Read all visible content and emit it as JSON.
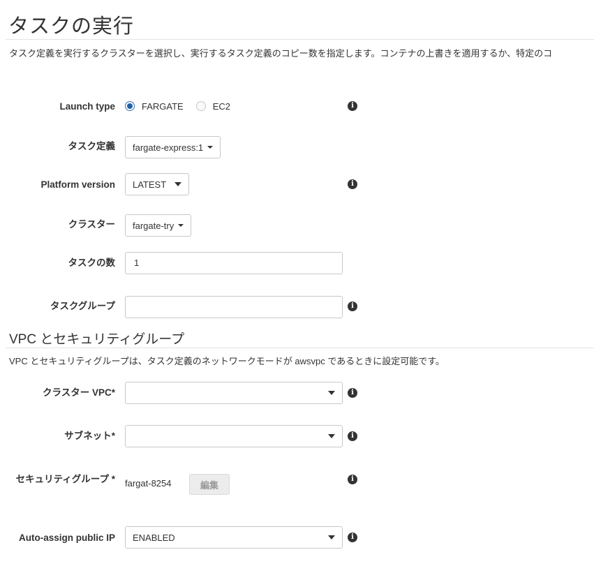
{
  "page": {
    "title": "タスクの実行",
    "description": "タスク定義を実行するクラスターを選択し、実行するタスク定義のコピー数を指定します。コンテナの上書きを適用するか、特定のコ"
  },
  "launch_type": {
    "label": "Launch type",
    "options": [
      "FARGATE",
      "EC2"
    ],
    "selected": "FARGATE"
  },
  "task_definition": {
    "label": "タスク定義",
    "value": "fargate-express:1"
  },
  "platform_version": {
    "label": "Platform version",
    "value": "LATEST"
  },
  "cluster": {
    "label": "クラスター",
    "value": "fargate-try"
  },
  "task_count": {
    "label": "タスクの数",
    "value": "1"
  },
  "task_group": {
    "label": "タスクグループ",
    "value": ""
  },
  "vpc_section": {
    "title": "VPC とセキュリティグループ",
    "description": "VPC とセキュリティグループは、タスク定義のネットワークモードが awsvpc であるときに設定可能です。"
  },
  "cluster_vpc": {
    "label": "クラスター VPC*",
    "value": ""
  },
  "subnet": {
    "label": "サブネット*",
    "value": ""
  },
  "security_group": {
    "label": "セキュリティグループ *",
    "value": "fargat-8254",
    "edit_label": "編集"
  },
  "auto_assign_ip": {
    "label": "Auto-assign public IP",
    "value": "ENABLED"
  },
  "icons": {
    "info": "info-icon",
    "info_glyph": "i"
  },
  "colors": {
    "radio_selected": "#1f5fa8",
    "border": "#c8c8c8",
    "text": "#333333"
  }
}
